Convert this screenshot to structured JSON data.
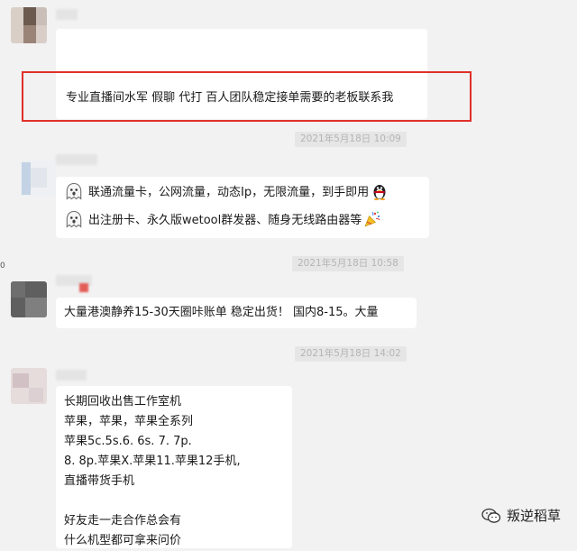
{
  "messages": [
    {
      "text": "专业直播间水军 假聊 代打 百人团队稳定接单需要的老板联系我"
    },
    {
      "lines": [
        "联通流量卡，公网流量，动态Ip，无限流量，到手即用",
        "出注册卡、永久版wetool群发器、随身无线路由器等"
      ]
    },
    {
      "text": "大量港澳静养15-30天圈咔账单  稳定出货！  国内8-15。大量"
    },
    {
      "lines": [
        "长期回收出售工作室机",
        "苹果，苹果，苹果全系列",
        "苹果5c.5s.6. 6s. 7. 7p.",
        "8. 8p.苹果X.苹果11.苹果12手机,",
        "直播带货手机",
        "",
        "好友走一走合作总会有",
        "什么机型都可拿来问价"
      ]
    }
  ],
  "timestamps": [
    "2021年5月18日 10:09",
    "2021年5月18日 10:58",
    "2021年5月18日 14:02"
  ],
  "watermark": {
    "text": "叛逆稻草"
  },
  "stray_mark": "0",
  "icons": {
    "ghost": "ghost-emoji-icon",
    "penguin": "qq-penguin-icon",
    "party": "party-popper-icon",
    "wechat": "wechat-logo-icon"
  },
  "colors": {
    "highlight_box": "#e0302a",
    "background": "#f2f2f2",
    "bubble": "#ffffff",
    "timestamp_bg": "#e6e6e6"
  }
}
